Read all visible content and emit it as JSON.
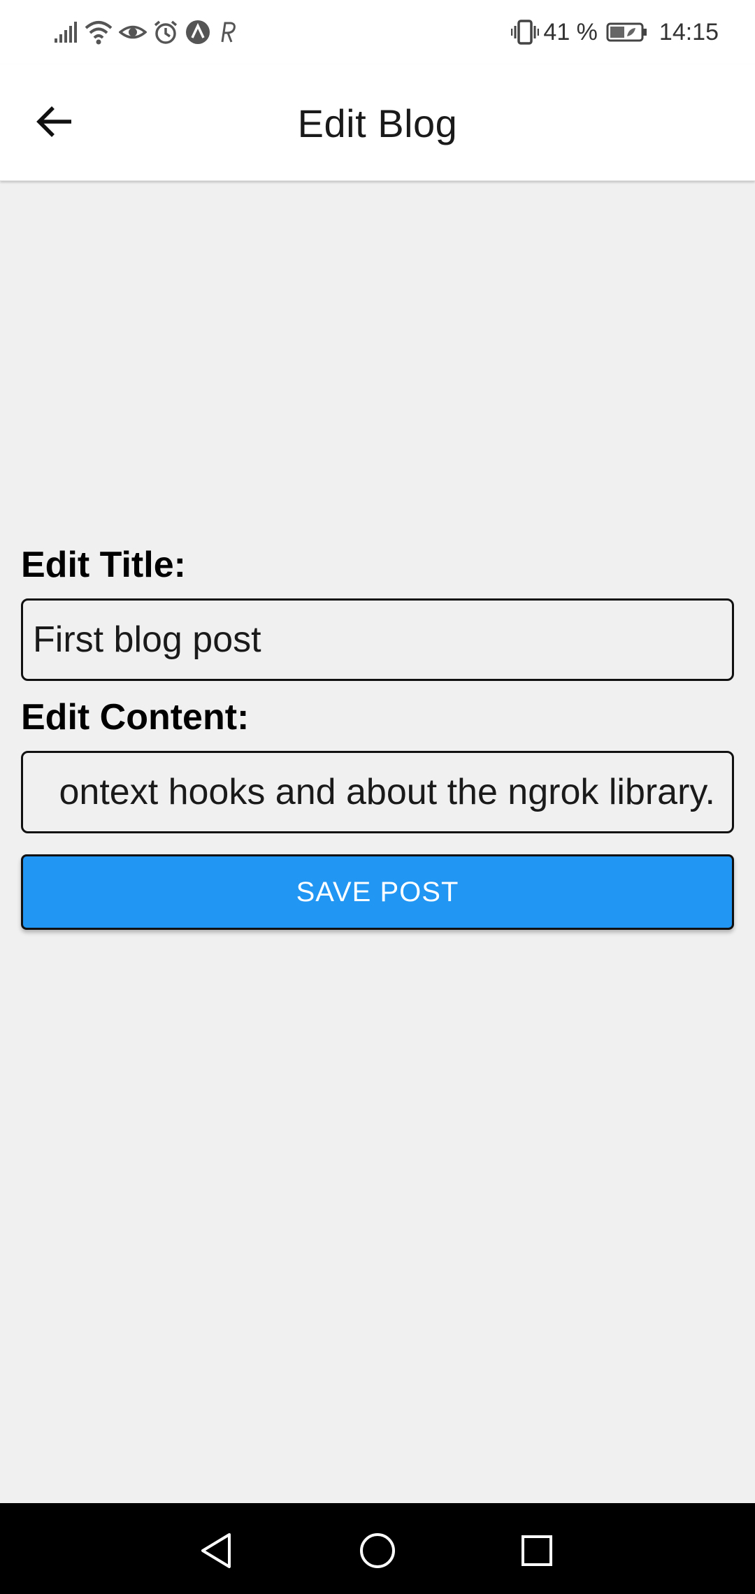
{
  "status_bar": {
    "battery_percent": "41 %",
    "time": "14:15",
    "left_icons": [
      "signal-icon",
      "wifi-icon",
      "eye-icon",
      "alarm-icon",
      "app-a-icon",
      "app-r-icon"
    ],
    "right_icons": [
      "vibrate-icon",
      "battery-icon"
    ]
  },
  "app_bar": {
    "title": "Edit Blog",
    "back_icon": "arrow-left-icon"
  },
  "form": {
    "title_label": "Edit Title:",
    "title_value": "First blog post",
    "content_label": "Edit Content:",
    "content_value": "ontext hooks and about the ngrok library.",
    "save_label": "SAVE POST"
  },
  "colors": {
    "accent": "#2196f3",
    "background": "#f0f0f0",
    "app_bar": "#ffffff",
    "nav_bar": "#000000"
  },
  "nav_bar": {
    "icons": [
      "nav-back-icon",
      "nav-home-icon",
      "nav-recents-icon"
    ]
  }
}
